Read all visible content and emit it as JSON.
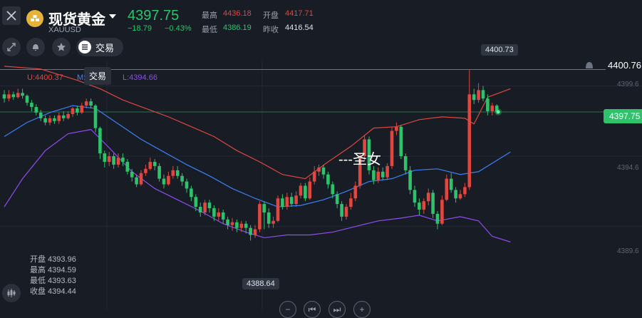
{
  "header": {
    "title": "现货黄金",
    "symbol": "XAUUSD",
    "price": "4397.75",
    "change": "−18.79",
    "change_pct": "−0.43%",
    "stats": {
      "high_label": "最高",
      "high_value": "4436.18",
      "open_label": "开盘",
      "open_value": "4417.71",
      "low_label": "最低",
      "low_value": "4386.19",
      "prev_label": "昨收",
      "prev_value": "4416.54"
    }
  },
  "toolbar": {
    "trade_label": "交易",
    "tooltip": "交易",
    "icons": [
      "close-icon",
      "expand-icon",
      "bell-icon",
      "star-icon",
      "list-icon"
    ]
  },
  "bollinger": {
    "upper": "U:4400.37",
    "mid": "M:",
    "lower": "L:4394.66"
  },
  "ohlc_panel": {
    "open": "开盘 4393.96",
    "high": "最高 4394.59",
    "low": "最低 4393.63",
    "close": "收盘 4394.44"
  },
  "annotations": {
    "high_callout": "4400.73",
    "low_callout": "4388.64",
    "line_price": "4400.76",
    "current_price": "4397.75",
    "watermark": "---圣女"
  },
  "axis": {
    "labels": [
      "4399.6",
      "4394.6",
      "4389.6"
    ]
  },
  "bottom_controls": [
    "−",
    "⏮",
    "⏭",
    "+"
  ],
  "colors": {
    "background": "#181c25",
    "up": "#e0473f",
    "down": "#2ec36b",
    "mid_band": "#3b82f6",
    "upper_band": "#e0473f",
    "lower_band": "#8f4df0",
    "text_label": "#9aa1ad"
  },
  "chart_data": {
    "type": "candlestick",
    "ylim": [
      4387.2,
      4401.4
    ],
    "candles": [
      [
        4399.0,
        4398.7,
        4399.3,
        4398.4
      ],
      [
        4398.7,
        4399.0,
        4399.3,
        4398.5
      ],
      [
        4399.0,
        4398.8,
        4399.2,
        4398.6
      ],
      [
        4398.8,
        4399.1,
        4399.4,
        4398.7
      ],
      [
        4399.1,
        4398.9,
        4399.4,
        4398.7
      ],
      [
        4398.9,
        4398.4,
        4399.0,
        4398.2
      ],
      [
        4398.4,
        4398.1,
        4398.6,
        4397.8
      ],
      [
        4398.1,
        4397.7,
        4398.3,
        4397.5
      ],
      [
        4397.7,
        4397.3,
        4397.9,
        4397.1
      ],
      [
        4397.3,
        4397.0,
        4397.5,
        4396.8
      ],
      [
        4397.0,
        4397.3,
        4397.5,
        4396.8
      ],
      [
        4397.3,
        4397.1,
        4397.5,
        4396.9
      ],
      [
        4397.1,
        4397.5,
        4397.7,
        4396.9
      ],
      [
        4397.5,
        4397.3,
        4397.8,
        4397.1
      ],
      [
        4397.3,
        4397.6,
        4397.8,
        4397.2
      ],
      [
        4397.6,
        4398.0,
        4398.1,
        4397.4
      ],
      [
        4398.0,
        4397.7,
        4398.2,
        4397.5
      ],
      [
        4397.7,
        4398.2,
        4398.4,
        4397.6
      ],
      [
        4398.2,
        4398.5,
        4398.7,
        4398.0
      ],
      [
        4398.5,
        4398.2,
        4398.7,
        4398.0
      ],
      [
        4398.2,
        4396.6,
        4398.3,
        4396.3
      ],
      [
        4396.6,
        4394.8,
        4396.7,
        4394.4
      ],
      [
        4394.8,
        4394.2,
        4395.0,
        4393.8
      ],
      [
        4394.2,
        4394.6,
        4394.9,
        4393.9
      ],
      [
        4394.6,
        4394.0,
        4394.8,
        4393.7
      ],
      [
        4394.0,
        4394.5,
        4394.8,
        4393.8
      ],
      [
        4394.5,
        4394.2,
        4394.8,
        4393.9
      ],
      [
        4394.2,
        4393.5,
        4394.4,
        4393.3
      ],
      [
        4393.5,
        4393.1,
        4393.7,
        4392.8
      ],
      [
        4393.1,
        4392.6,
        4393.3,
        4392.4
      ],
      [
        4392.6,
        4393.4,
        4393.6,
        4392.5
      ],
      [
        4393.4,
        4393.7,
        4394.0,
        4393.2
      ],
      [
        4393.7,
        4394.2,
        4394.5,
        4393.6
      ],
      [
        4394.2,
        4393.9,
        4394.4,
        4393.6
      ],
      [
        4393.9,
        4393.0,
        4394.1,
        4392.8
      ],
      [
        4393.0,
        4392.6,
        4393.3,
        4392.3
      ],
      [
        4392.6,
        4393.2,
        4393.5,
        4392.5
      ],
      [
        4393.2,
        4393.6,
        4393.9,
        4393.0
      ],
      [
        4393.6,
        4393.2,
        4393.9,
        4393.0
      ],
      [
        4393.2,
        4392.8,
        4393.4,
        4392.5
      ],
      [
        4392.8,
        4392.3,
        4393.0,
        4392.0
      ],
      [
        4392.3,
        4391.7,
        4392.5,
        4391.4
      ],
      [
        4391.7,
        4391.0,
        4391.9,
        4390.7
      ],
      [
        4391.0,
        4390.6,
        4391.3,
        4390.3
      ],
      [
        4390.6,
        4391.3,
        4391.5,
        4390.4
      ],
      [
        4391.3,
        4390.9,
        4391.5,
        4390.6
      ],
      [
        4390.9,
        4390.3,
        4391.1,
        4390.0
      ],
      [
        4390.3,
        4390.6,
        4390.9,
        4390.0
      ],
      [
        4390.6,
        4390.1,
        4390.8,
        4389.8
      ],
      [
        4390.1,
        4389.7,
        4390.3,
        4389.4
      ],
      [
        4389.7,
        4389.9,
        4390.2,
        4389.3
      ],
      [
        4389.9,
        4389.5,
        4390.1,
        4389.2
      ],
      [
        4389.5,
        4389.8,
        4390.0,
        4389.2
      ],
      [
        4389.8,
        4389.5,
        4390.0,
        4389.1
      ],
      [
        4389.5,
        4389.0,
        4389.7,
        4388.6
      ],
      [
        4389.0,
        4389.4,
        4389.7,
        4388.8
      ],
      [
        4389.4,
        4391.2,
        4391.4,
        4389.2
      ],
      [
        4391.2,
        4390.6,
        4391.4,
        4389.4
      ],
      [
        4390.6,
        4389.8,
        4390.9,
        4389.5
      ],
      [
        4389.8,
        4390.0,
        4390.3,
        4389.5
      ],
      [
        4390.0,
        4391.6,
        4391.8,
        4389.9
      ],
      [
        4391.6,
        4391.0,
        4391.9,
        4390.8
      ],
      [
        4391.0,
        4391.7,
        4392.0,
        4390.8
      ],
      [
        4391.7,
        4391.2,
        4392.0,
        4391.0
      ],
      [
        4391.2,
        4391.8,
        4392.1,
        4391.0
      ],
      [
        4391.8,
        4392.5,
        4392.7,
        4391.6
      ],
      [
        4392.5,
        4391.6,
        4392.7,
        4391.4
      ],
      [
        4391.6,
        4392.8,
        4393.1,
        4391.5
      ],
      [
        4392.8,
        4393.5,
        4393.9,
        4392.6
      ],
      [
        4393.5,
        4393.8,
        4394.0,
        4393.2
      ],
      [
        4393.8,
        4393.3,
        4394.0,
        4393.0
      ],
      [
        4393.3,
        4392.6,
        4393.5,
        4392.3
      ],
      [
        4392.6,
        4391.9,
        4392.8,
        4391.6
      ],
      [
        4391.9,
        4391.2,
        4392.1,
        4390.9
      ],
      [
        4391.2,
        4390.3,
        4391.4,
        4390.0
      ],
      [
        4390.3,
        4391.0,
        4391.2,
        4390.1
      ],
      [
        4391.0,
        4391.6,
        4392.0,
        4390.8
      ],
      [
        4391.6,
        4392.5,
        4392.8,
        4391.4
      ],
      [
        4392.5,
        4394.6,
        4394.8,
        4392.3
      ],
      [
        4394.6,
        4395.8,
        4396.1,
        4394.3
      ],
      [
        4395.8,
        4393.6,
        4396.0,
        4393.3
      ],
      [
        4393.6,
        4392.9,
        4393.9,
        4392.6
      ],
      [
        4392.9,
        4393.5,
        4393.8,
        4392.7
      ],
      [
        4393.5,
        4393.1,
        4393.8,
        4392.9
      ],
      [
        4393.1,
        4393.9,
        4394.1,
        4392.9
      ],
      [
        4393.9,
        4396.4,
        4396.7,
        4393.7
      ],
      [
        4396.4,
        4396.7,
        4397.0,
        4396.1
      ],
      [
        4396.7,
        4394.6,
        4396.8,
        4394.4
      ],
      [
        4394.6,
        4393.6,
        4394.8,
        4393.3
      ],
      [
        4393.6,
        4392.2,
        4393.9,
        4391.9
      ],
      [
        4392.2,
        4391.3,
        4392.5,
        4391.0
      ],
      [
        4391.3,
        4390.8,
        4391.6,
        4390.4
      ],
      [
        4390.8,
        4391.4,
        4391.6,
        4390.5
      ],
      [
        4391.4,
        4392.0,
        4392.3,
        4391.1
      ],
      [
        4392.0,
        4390.5,
        4392.2,
        4390.2
      ],
      [
        4390.5,
        4389.8,
        4390.7,
        4389.4
      ],
      [
        4389.8,
        4391.5,
        4391.8,
        4389.7
      ],
      [
        4391.5,
        4393.0,
        4393.3,
        4391.4
      ],
      [
        4393.0,
        4392.2,
        4393.4,
        4392.0
      ],
      [
        4392.2,
        4391.6,
        4392.4,
        4391.3
      ],
      [
        4391.6,
        4391.9,
        4392.2,
        4391.5
      ],
      [
        4391.9,
        4392.4,
        4392.7,
        4391.7
      ],
      [
        4392.4,
        4399.0,
        4400.73,
        4392.2
      ],
      [
        4399.0,
        4398.6,
        4399.4,
        4398.3
      ],
      [
        4398.6,
        4399.3,
        4399.8,
        4398.4
      ],
      [
        4399.3,
        4398.7,
        4399.6,
        4398.5
      ],
      [
        4398.7,
        4397.8,
        4399.0,
        4397.5
      ],
      [
        4397.8,
        4398.2,
        4398.4,
        4397.5
      ],
      [
        4398.2,
        4397.75,
        4398.3,
        4397.6
      ]
    ],
    "upper_band": [
      [
        0,
        4401.0
      ],
      [
        8,
        4400.8
      ],
      [
        16,
        4400.0
      ],
      [
        21,
        4399.4
      ],
      [
        26,
        4398.6
      ],
      [
        31,
        4398.0
      ],
      [
        36,
        4397.4
      ],
      [
        41,
        4396.7
      ],
      [
        46,
        4396.0
      ],
      [
        51,
        4395.0
      ],
      [
        56,
        4394.2
      ],
      [
        61,
        4393.3
      ],
      [
        66,
        4393.0
      ],
      [
        71,
        4394.2
      ],
      [
        76,
        4395.3
      ],
      [
        81,
        4396.6
      ],
      [
        86,
        4396.7
      ],
      [
        91,
        4397.2
      ],
      [
        96,
        4397.4
      ],
      [
        101,
        4397.3
      ],
      [
        103,
        4396.9
      ],
      [
        106,
        4398.8
      ],
      [
        111,
        4399.4
      ]
    ],
    "mid_band": [
      [
        0,
        4396.0
      ],
      [
        5,
        4397.0
      ],
      [
        10,
        4397.7
      ],
      [
        15,
        4398.2
      ],
      [
        20,
        4398.0
      ],
      [
        25,
        4396.9
      ],
      [
        30,
        4395.8
      ],
      [
        35,
        4394.9
      ],
      [
        40,
        4394.0
      ],
      [
        45,
        4393.2
      ],
      [
        50,
        4392.3
      ],
      [
        55,
        4391.6
      ],
      [
        60,
        4391.0
      ],
      [
        65,
        4391.1
      ],
      [
        70,
        4391.5
      ],
      [
        75,
        4392.1
      ],
      [
        80,
        4392.8
      ],
      [
        85,
        4393.0
      ],
      [
        90,
        4393.6
      ],
      [
        95,
        4393.7
      ],
      [
        100,
        4393.3
      ],
      [
        104,
        4393.5
      ],
      [
        111,
        4394.9
      ]
    ],
    "lower_band": [
      [
        0,
        4391.0
      ],
      [
        4,
        4393.0
      ],
      [
        9,
        4395.0
      ],
      [
        14,
        4396.2
      ],
      [
        19,
        4396.5
      ],
      [
        23,
        4395.2
      ],
      [
        28,
        4393.5
      ],
      [
        33,
        4392.3
      ],
      [
        38,
        4391.5
      ],
      [
        43,
        4390.7
      ],
      [
        48,
        4389.8
      ],
      [
        53,
        4389.2
      ],
      [
        57,
        4388.8
      ],
      [
        62,
        4389.0
      ],
      [
        67,
        4389.0
      ],
      [
        72,
        4389.2
      ],
      [
        77,
        4389.6
      ],
      [
        82,
        4390.0
      ],
      [
        87,
        4390.2
      ],
      [
        91,
        4390.4
      ],
      [
        95,
        4390.0
      ],
      [
        100,
        4390.3
      ],
      [
        104,
        4390.0
      ],
      [
        107,
        4388.9
      ],
      [
        111,
        4388.5
      ]
    ],
    "hline_price": 4400.76,
    "current_price": 4397.75
  }
}
